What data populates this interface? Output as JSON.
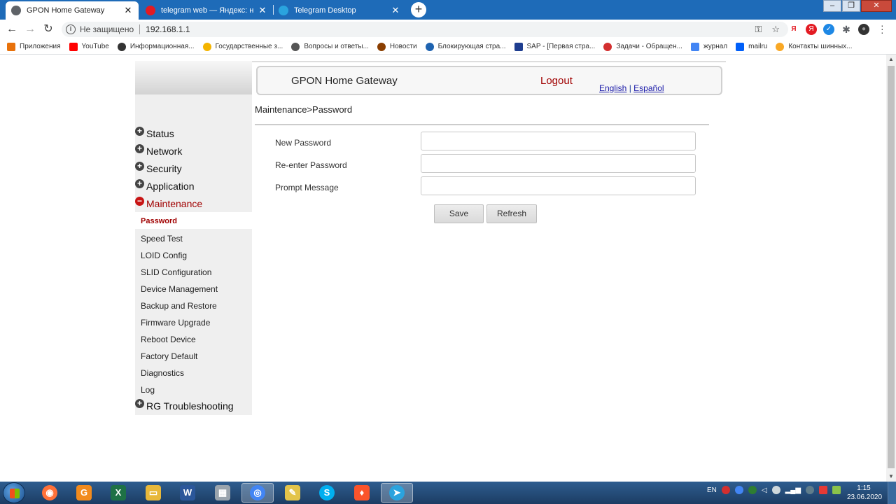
{
  "browser": {
    "tabs": [
      {
        "title": "GPON Home Gateway",
        "icon_color": "#5f6368"
      },
      {
        "title": "telegram web — Яндекс: нашлось",
        "icon_color": "#e31b23"
      },
      {
        "title": "Telegram Desktop",
        "icon_color": "#2aa3de"
      }
    ],
    "tab_close_glyph": "✕",
    "new_tab_glyph": "+",
    "window_controls": {
      "minimize": "–",
      "maximize": "❐",
      "close": "✕"
    },
    "nav": {
      "back": "←",
      "forward": "→",
      "reload": "↻"
    },
    "address": {
      "security_text": "Не защищено",
      "url": "192.168.1.1"
    },
    "omnibox_icons": [
      "key-icon",
      "star-icon"
    ],
    "extensions": [
      {
        "glyph": "Я",
        "color": "#e31b23"
      },
      {
        "glyph": "Я",
        "color": "#e31b23"
      },
      {
        "glyph": "✓",
        "color": "#1e88e5"
      },
      {
        "glyph": "✱",
        "color": "#5f6368"
      },
      {
        "glyph": "●",
        "color": "#333333"
      }
    ],
    "bookmarks": [
      {
        "label": "Приложения",
        "color": "#e8710a"
      },
      {
        "label": "YouTube",
        "color": "#ff0000"
      },
      {
        "label": "Информационная...",
        "color": "#333333"
      },
      {
        "label": "Государственные з...",
        "color": "#f4b400"
      },
      {
        "label": "Вопросы и ответы...",
        "color": "#555555"
      },
      {
        "label": "Новости",
        "color": "#8a3e00"
      },
      {
        "label": "Блокирующая стра...",
        "color": "#1e63b0"
      },
      {
        "label": "SAP - [Первая стра...",
        "color": "#1e3d8f"
      },
      {
        "label": "Задачи - Обращен...",
        "color": "#d32f2f"
      },
      {
        "label": "журнал",
        "color": "#4285f4"
      },
      {
        "label": "mailru",
        "color": "#005ff9"
      },
      {
        "label": "Контакты шинных...",
        "color": "#f9a825"
      }
    ]
  },
  "page": {
    "header": {
      "title": "GPON Home Gateway",
      "logout": "Logout",
      "lang_english": "English",
      "lang_separator": "|",
      "lang_spanish": "Español"
    },
    "menu": {
      "expand_glyph": "+",
      "collapse_glyph": "−",
      "items": [
        "Status",
        "Network",
        "Security",
        "Application",
        "Maintenance",
        "RG Troubleshooting"
      ],
      "maintenance_sub": [
        "Password",
        "Speed Test",
        "LOID Config",
        "SLID Configuration",
        "Device Management",
        "Backup and Restore",
        "Firmware Upgrade",
        "Reboot Device",
        "Factory Default",
        "Diagnostics",
        "Log"
      ]
    },
    "breadcrumb": "Maintenance>Password",
    "form": {
      "new_password_label": "New Password",
      "reenter_password_label": "Re-enter Password",
      "prompt_message_label": "Prompt Message",
      "new_password_value": "",
      "reenter_password_value": "",
      "prompt_message_value": "",
      "save": "Save",
      "refresh": "Refresh"
    }
  },
  "taskbar": {
    "apps": [
      {
        "name": "firefox",
        "glyph": "◉",
        "color": "#ff7139"
      },
      {
        "name": "pdf",
        "glyph": "G",
        "color": "#f28b1d"
      },
      {
        "name": "excel",
        "glyph": "X",
        "color": "#1e7145"
      },
      {
        "name": "explorer",
        "glyph": "▭",
        "color": "#e8b83a"
      },
      {
        "name": "word",
        "glyph": "W",
        "color": "#2b579a"
      },
      {
        "name": "calculator",
        "glyph": "▦",
        "color": "#9aa4ad"
      },
      {
        "name": "chrome",
        "glyph": "◎",
        "color": "#4285f4"
      },
      {
        "name": "notes",
        "glyph": "✎",
        "color": "#e3c44a"
      },
      {
        "name": "skype",
        "glyph": "S",
        "color": "#00aff0"
      },
      {
        "name": "brave",
        "glyph": "♦",
        "color": "#fb542b"
      },
      {
        "name": "telegram",
        "glyph": "➤",
        "color": "#2aa3de"
      }
    ],
    "language": "EN",
    "time": "1:15",
    "date": "23.06.2020"
  }
}
